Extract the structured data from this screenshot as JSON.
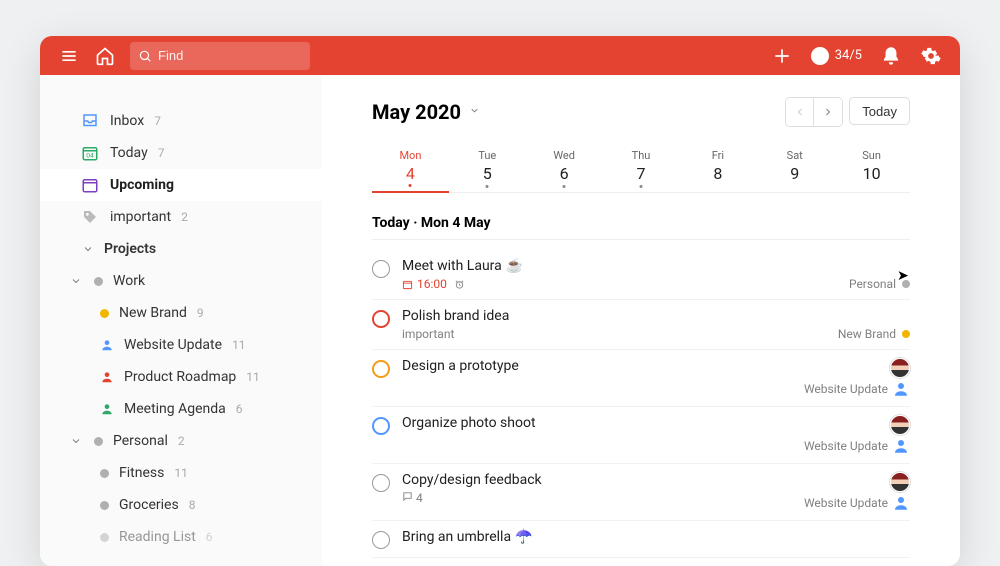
{
  "topbar": {
    "search_placeholder": "Find",
    "karma_count": "34/5"
  },
  "sidebar": {
    "inbox_label": "Inbox",
    "inbox_count": "7",
    "today_label": "Today",
    "today_count": "7",
    "upcoming_label": "Upcoming",
    "important_label": "important",
    "important_count": "2",
    "projects_label": "Projects",
    "work_label": "Work",
    "new_brand_label": "New Brand",
    "new_brand_count": "9",
    "website_update_label": "Website Update",
    "website_update_count": "11",
    "product_roadmap_label": "Product Roadmap",
    "product_roadmap_count": "11",
    "meeting_agenda_label": "Meeting Agenda",
    "meeting_agenda_count": "6",
    "personal_label": "Personal",
    "personal_count": "2",
    "fitness_label": "Fitness",
    "fitness_count": "11",
    "groceries_label": "Groceries",
    "groceries_count": "8",
    "reading_list_label": "Reading List",
    "reading_list_count": "6"
  },
  "main": {
    "month_title": "May 2020",
    "today_btn": "Today",
    "days": [
      {
        "name": "Mon",
        "num": "4"
      },
      {
        "name": "Tue",
        "num": "5"
      },
      {
        "name": "Wed",
        "num": "6"
      },
      {
        "name": "Thu",
        "num": "7"
      },
      {
        "name": "Fri",
        "num": "8"
      },
      {
        "name": "Sat",
        "num": "9"
      },
      {
        "name": "Sun",
        "num": "10"
      }
    ],
    "section_title": "Today · Mon 4 May",
    "tasks": [
      {
        "title": "Meet with Laura",
        "emoji": "☕",
        "time": "16:00",
        "project": "Personal",
        "proj_color": "grey",
        "has_reminder": true
      },
      {
        "title": "Polish brand idea",
        "meta": "important",
        "project": "New Brand",
        "proj_color": "yellow",
        "priority": "p1"
      },
      {
        "title": "Design a prototype",
        "project": "Website Update",
        "has_avatar": true,
        "has_assignee": true,
        "priority": "p2"
      },
      {
        "title": "Organize photo shoot",
        "project": "Website Update",
        "has_avatar": true,
        "has_assignee": true,
        "priority": "p3"
      },
      {
        "title": "Copy/design feedback",
        "comments": "4",
        "project": "Website Update",
        "has_avatar": true,
        "has_assignee": true
      },
      {
        "title": "Bring an umbrella",
        "emoji": "☂️"
      }
    ]
  }
}
